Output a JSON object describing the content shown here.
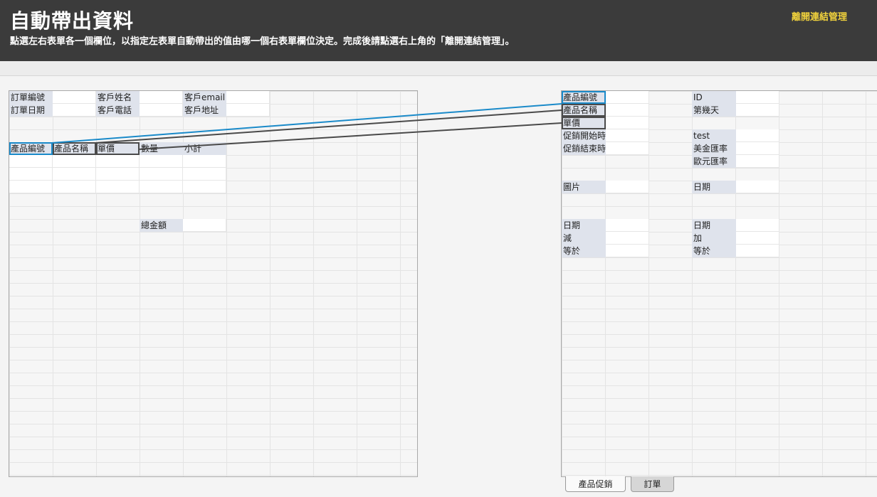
{
  "header": {
    "title": "自動帶出資料",
    "subtitle": "點選左右表單各一個欄位，以指定左表單自動帶出的值由哪一個右表單欄位決定。完成後請點選右上角的「離開連結管理」。",
    "exit_label": "離開連結管理"
  },
  "left_form": {
    "order_no": "訂單編號",
    "customer_name": "客戶姓名",
    "customer_email": "客戶email",
    "order_date": "訂單日期",
    "customer_phone": "客戶電話",
    "customer_address": "客戶地址",
    "detail_headers": [
      "產品編號",
      "產品名稱",
      "單價",
      "數量",
      "小計"
    ],
    "total_label": "總金額"
  },
  "right_form": {
    "product_no": "產品編號",
    "id": "ID",
    "product_name": "產品名稱",
    "nth_day": "第幾天",
    "unit_price": "單價",
    "promo_start": "促銷開始時間",
    "test": "test",
    "promo_end": "促銷結束時間",
    "usd_rate": "美金匯率",
    "eur_rate": "歐元匯率",
    "image": "圖片",
    "date_a": "日期",
    "date_b": "日期",
    "date_c": "日期",
    "minus": "減",
    "plus": "加",
    "equals_a": "等於",
    "equals_b": "等於"
  },
  "tabs": [
    "產品促銷",
    "訂單"
  ],
  "colors": {
    "header_bg": "#3b3b3b",
    "exit_link": "#f2d33c",
    "link_active": "#1a8ac9",
    "link_other": "#4a4a4a",
    "label_bg": "#dfe3ec"
  }
}
